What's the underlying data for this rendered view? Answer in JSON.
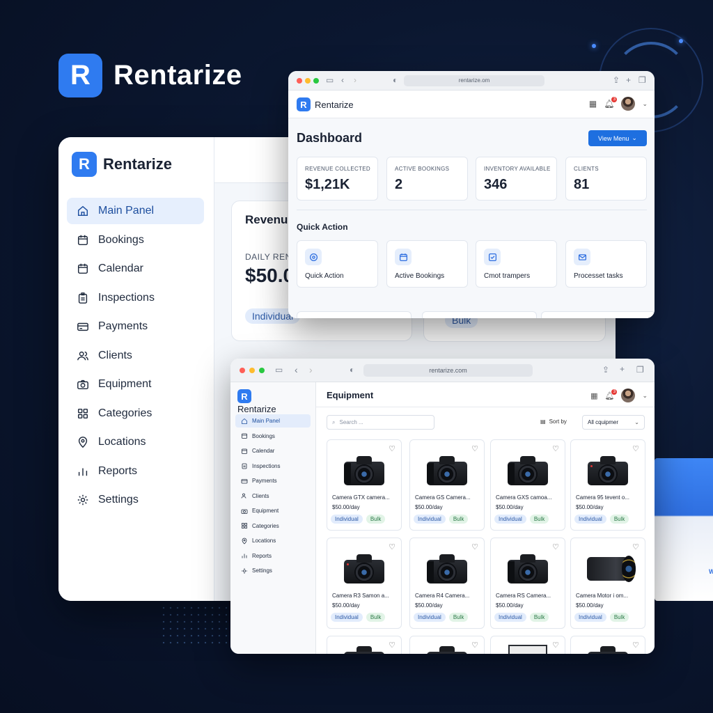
{
  "brand": {
    "name": "Rentarize",
    "logo_letter": "R",
    "accent": "#2f7bf0"
  },
  "back_window": {
    "logo_name": "Rentarize",
    "nav": [
      {
        "label": "Main Panel",
        "icon": "home-icon",
        "active": true
      },
      {
        "label": "Bookings",
        "icon": "calendar-icon"
      },
      {
        "label": "Calendar",
        "icon": "calendar-icon"
      },
      {
        "label": "Inspections",
        "icon": "clipboard-icon"
      },
      {
        "label": "Payments",
        "icon": "card-icon"
      },
      {
        "label": "Clients",
        "icon": "users-icon"
      },
      {
        "label": "Equipment",
        "icon": "camera-icon"
      },
      {
        "label": "Categories",
        "icon": "grid-icon"
      },
      {
        "label": "Locations",
        "icon": "pin-icon"
      },
      {
        "label": "Reports",
        "icon": "bar-chart-icon"
      },
      {
        "label": "Settings",
        "icon": "gear-icon"
      }
    ],
    "revenue_card": {
      "title": "Revenue",
      "label": "DAILY RENT",
      "value": "$50.0",
      "tag": "Individual"
    },
    "second_card": {
      "tag": "Bulk"
    }
  },
  "dashboard_window": {
    "url": "rentarize.om",
    "app_name": "Rentarize",
    "notification_count": "3",
    "title": "Dashboard",
    "view_button": "View Menu",
    "stats": [
      {
        "label": "REVENUE COLLECTED",
        "value": "$1,21K"
      },
      {
        "label": "ACTIVE BOOKINGS",
        "value": "2"
      },
      {
        "label": "INVENTORY AVAILABLE",
        "value": "346"
      },
      {
        "label": "CLIENTS",
        "value": "81"
      }
    ],
    "quick_action_title": "Quick Action",
    "quick_actions": [
      {
        "label": "Quick Action",
        "icon": "target-icon"
      },
      {
        "label": "Active Bookings",
        "icon": "calendar-icon"
      },
      {
        "label": "Cmot trampers",
        "icon": "check-square-icon"
      },
      {
        "label": "Processet tasks",
        "icon": "mail-icon"
      }
    ]
  },
  "equipment_window": {
    "url": "rentarize.com",
    "app_name": "Rentarize",
    "notification_count": "3",
    "title": "Equipment",
    "search_placeholder": "Search ...",
    "sort_label": "Sort by",
    "sort_value": "All cquipmer",
    "nav": [
      {
        "label": "Main Panel",
        "icon": "home-icon",
        "active": true
      },
      {
        "label": "Bookings",
        "icon": "calendar-icon"
      },
      {
        "label": "Calendar",
        "icon": "calendar-icon"
      },
      {
        "label": "Inspections",
        "icon": "clipboard-icon"
      },
      {
        "label": "Payments",
        "icon": "card-icon"
      },
      {
        "label": "Clients",
        "icon": "users-icon"
      },
      {
        "label": "Equipment",
        "icon": "camera-icon"
      },
      {
        "label": "Categories",
        "icon": "grid-icon"
      },
      {
        "label": "Locations",
        "icon": "pin-icon"
      },
      {
        "label": "Reports",
        "icon": "bar-chart-icon"
      },
      {
        "label": "Settings",
        "icon": "gear-icon"
      }
    ],
    "items": [
      {
        "name": "Camera GTX camera...",
        "price": "$50.00/day",
        "tag1": "Individual",
        "tag2": "Bulk",
        "image": "dslr-camera"
      },
      {
        "name": "Camera GS Camera...",
        "price": "$50.00/day",
        "tag1": "Individual",
        "tag2": "Bulk",
        "image": "dslr-camera"
      },
      {
        "name": "Camera GXS camoa...",
        "price": "$50.00/day",
        "tag1": "Individual",
        "tag2": "Bulk",
        "image": "dslr-camera"
      },
      {
        "name": "Camera 95 tevent o...",
        "price": "$50.00/day",
        "tag1": "Individual",
        "tag2": "Bulk",
        "image": "mirrorless-camera"
      },
      {
        "name": "Camera R3 Samon a...",
        "price": "$50.00/day",
        "tag1": "Individual",
        "tag2": "Bulk",
        "image": "mirrorless-camera"
      },
      {
        "name": "Camera R4 Camera...",
        "price": "$50.00/day",
        "tag1": "Individual",
        "tag2": "Bulk",
        "image": "dslr-camera"
      },
      {
        "name": "Camera RS Camera...",
        "price": "$50.00/day",
        "tag1": "Individual",
        "tag2": "Bulk",
        "image": "dslr-camera"
      },
      {
        "name": "Camera Motor i om...",
        "price": "$50.00/day",
        "tag1": "Individual",
        "tag2": "Bulk",
        "image": "telephoto-lens"
      }
    ]
  }
}
